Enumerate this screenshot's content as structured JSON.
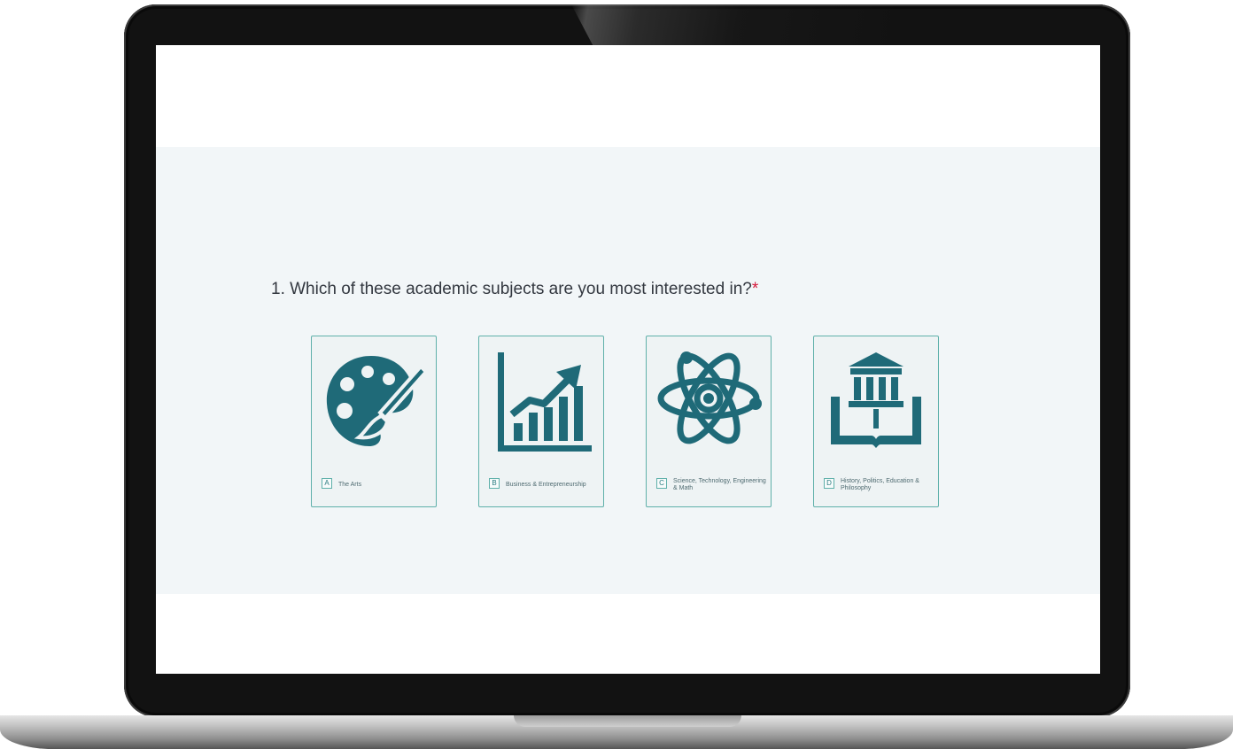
{
  "question": {
    "text": "1. Which of these academic subjects are you most interested in?",
    "required_marker": "*"
  },
  "options": [
    {
      "key": "A",
      "label": "The Arts",
      "icon": "palette-icon"
    },
    {
      "key": "B",
      "label": "Business & Entrepreneurship",
      "icon": "growth-chart-icon"
    },
    {
      "key": "C",
      "label": "Science, Technology, Engineering & Math",
      "icon": "atom-icon"
    },
    {
      "key": "D",
      "label": "History, Politics, Education & Philosophy",
      "icon": "institution-book-icon"
    }
  ],
  "colors": {
    "accent": "#1f6a78",
    "border": "#5fb0aa",
    "required": "#d61a3c",
    "band": "#f2f6f8"
  }
}
